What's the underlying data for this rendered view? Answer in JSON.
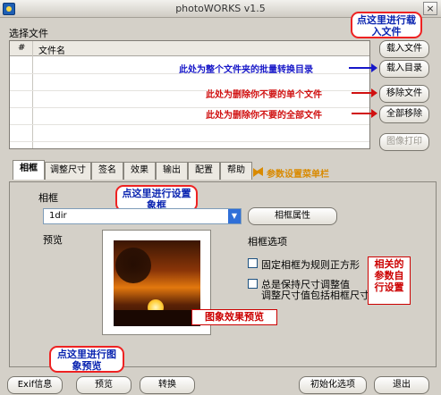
{
  "window": {
    "title": "photoWORKS v1.5",
    "close_glyph": "×"
  },
  "file_section": {
    "label": "选择文件",
    "columns": [
      "#",
      "文件名"
    ]
  },
  "side_buttons": {
    "load_file": "载入文件",
    "load_dir": "载入目录",
    "remove_file": "移除文件",
    "remove_all": "全部移除",
    "print": "图像打印"
  },
  "annotations": {
    "load_file": "点这里进行载入文件",
    "load_dir": "此处为整个文件夹的批量转换目录",
    "remove_file": "此处为删除你不要的单个文件",
    "remove_all": "此处为删除你不要的全部文件",
    "menu_bar": "参数设置菜单栏",
    "frame_setting": "点这里进行设置象框",
    "options_note": "相关的参数自行设置",
    "preview_effect": "图象效果预览",
    "preview_button": "点这里进行图象预览"
  },
  "tabs": [
    "相框",
    "调整尺寸",
    "签名",
    "效果",
    "输出",
    "配置",
    "帮助"
  ],
  "frame_panel": {
    "frame_label": "相框",
    "frame_value": "1dir",
    "frame_props_button": "相框属性",
    "preview_label": "预览",
    "options_title": "相框选项",
    "option_fixed_square": "固定相框为规则正方形",
    "option_keep_size_line1": "总是保持尺寸调整值",
    "option_keep_size_line2": "调整尺寸值包括相框尺寸"
  },
  "bottom_buttons": {
    "exif": "Exif信息",
    "preview": "预览",
    "convert": "转换",
    "init_options": "初始化选项",
    "exit": "退出"
  },
  "colors": {
    "note_blue": "#1717c8",
    "note_red": "#d01010",
    "callout_border": "#e22222"
  }
}
